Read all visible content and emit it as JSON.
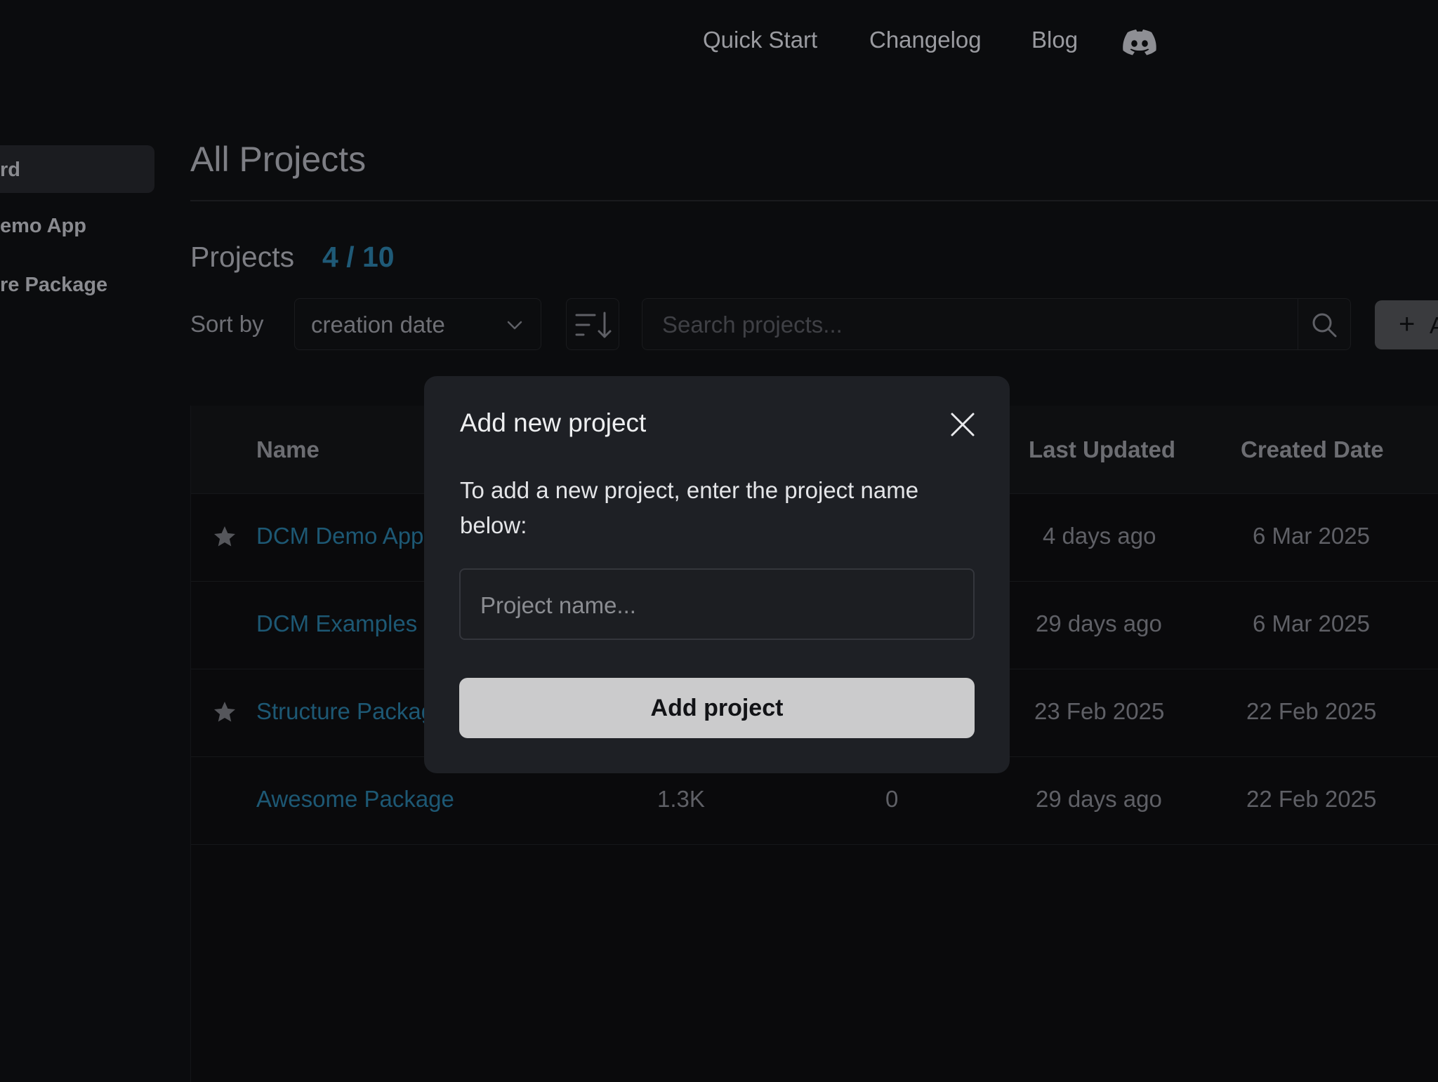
{
  "nav": {
    "links": [
      "Quick Start",
      "Changelog",
      "Blog"
    ],
    "discord_icon": "discord-icon"
  },
  "sidebar": {
    "items": [
      {
        "label": "rd"
      },
      {
        "label": "emo App"
      },
      {
        "label": "re Package"
      }
    ]
  },
  "main": {
    "title": "All Projects",
    "projects_label": "Projects",
    "projects_count": "4 / 10",
    "sort_label": "Sort by",
    "sort_value": "creation date",
    "search_placeholder": "Search projects...",
    "add_button_partial": "A"
  },
  "table": {
    "columns": [
      "Name",
      "Last Updated",
      "Created Date"
    ],
    "rows": [
      {
        "starred": true,
        "name": "DCM Demo App",
        "col2": "",
        "col3": "",
        "last_updated": "4 days ago",
        "created": "6 Mar 2025"
      },
      {
        "starred": false,
        "name": "DCM Examples",
        "col2": "",
        "col3": "",
        "last_updated": "29 days ago",
        "created": "6 Mar 2025"
      },
      {
        "starred": true,
        "name": "Structure Package",
        "col2": "",
        "col3": "",
        "last_updated": "23 Feb 2025",
        "created": "22 Feb 2025"
      },
      {
        "starred": false,
        "name": "Awesome Package",
        "col2": "1.3K",
        "col3": "0",
        "last_updated": "29 days ago",
        "created": "22 Feb 2025"
      }
    ]
  },
  "modal": {
    "title": "Add new project",
    "description": "To add a new project, enter the project name below:",
    "input_placeholder": "Project name...",
    "input_value": "",
    "submit_label": "Add project"
  },
  "colors": {
    "accent_link": "#1d5874",
    "modal_bg": "#1e2025",
    "submit_bg": "#cbcbcc"
  }
}
